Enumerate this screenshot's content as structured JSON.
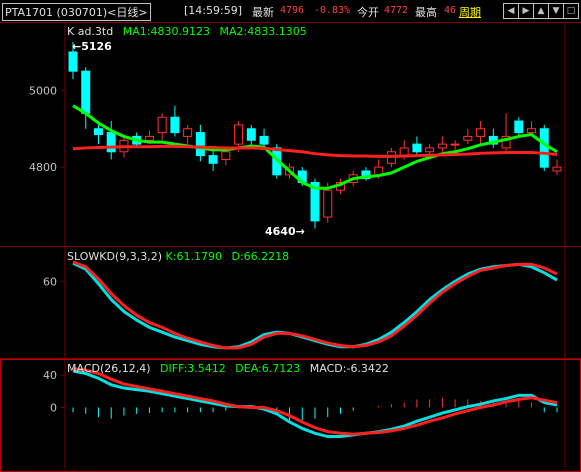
{
  "topbar": {
    "symbol": "PTA1701",
    "contract": "(030701)",
    "period_label": "<日线>",
    "time": "[14:59:59]",
    "last_label": "最新",
    "last_value": "4796",
    "change": "-0.83%",
    "open_label": "今开",
    "open_value": "4772",
    "high_label": "最高",
    "high_value": "46",
    "period_button": "周期",
    "nav_icons": [
      "arrow-left-icon",
      "arrow-right-icon",
      "zoom-in-icon",
      "zoom-out-icon",
      "expand-icon"
    ]
  },
  "colors": {
    "up": "#ff3030",
    "down": "#00ffff",
    "ma1": "#ffffff",
    "ma2": "#00ff00",
    "axis": "#800000"
  },
  "chart_data": [
    {
      "type": "candlestick",
      "name": "K ad.3td",
      "indicators": [
        {
          "label": "MA1",
          "value": "4830.9123"
        },
        {
          "label": "MA2",
          "value": "4833.1305"
        }
      ],
      "yticks": [
        5000,
        4800
      ],
      "ylim": [
        4605,
        5165
      ],
      "annotations": {
        "high": "5126",
        "low": "4640"
      },
      "candles": [
        {
          "o": 5100,
          "c": 5050,
          "h": 5126,
          "l": 5030
        },
        {
          "o": 5050,
          "c": 4940,
          "h": 5060,
          "l": 4900
        },
        {
          "o": 4900,
          "c": 4885,
          "h": 4920,
          "l": 4860
        },
        {
          "o": 4890,
          "c": 4840,
          "h": 4920,
          "l": 4820
        },
        {
          "o": 4840,
          "c": 4870,
          "h": 4880,
          "l": 4825
        },
        {
          "o": 4880,
          "c": 4860,
          "h": 4890,
          "l": 4850
        },
        {
          "o": 4870,
          "c": 4880,
          "h": 4895,
          "l": 4860
        },
        {
          "o": 4890,
          "c": 4930,
          "h": 4940,
          "l": 4870
        },
        {
          "o": 4930,
          "c": 4890,
          "h": 4960,
          "l": 4880
        },
        {
          "o": 4880,
          "c": 4900,
          "h": 4910,
          "l": 4860
        },
        {
          "o": 4890,
          "c": 4830,
          "h": 4910,
          "l": 4815
        },
        {
          "o": 4830,
          "c": 4810,
          "h": 4850,
          "l": 4790
        },
        {
          "o": 4820,
          "c": 4840,
          "h": 4850,
          "l": 4805
        },
        {
          "o": 4860,
          "c": 4910,
          "h": 4920,
          "l": 4840
        },
        {
          "o": 4900,
          "c": 4870,
          "h": 4910,
          "l": 4850
        },
        {
          "o": 4880,
          "c": 4860,
          "h": 4900,
          "l": 4850
        },
        {
          "o": 4850,
          "c": 4780,
          "h": 4860,
          "l": 4770
        },
        {
          "o": 4780,
          "c": 4800,
          "h": 4810,
          "l": 4770
        },
        {
          "o": 4790,
          "c": 4760,
          "h": 4800,
          "l": 4750
        },
        {
          "o": 4760,
          "c": 4660,
          "h": 4770,
          "l": 4640
        },
        {
          "o": 4670,
          "c": 4740,
          "h": 4760,
          "l": 4655
        },
        {
          "o": 4740,
          "c": 4760,
          "h": 4770,
          "l": 4730
        },
        {
          "o": 4760,
          "c": 4780,
          "h": 4790,
          "l": 4750
        },
        {
          "o": 4790,
          "c": 4770,
          "h": 4800,
          "l": 4765
        },
        {
          "o": 4780,
          "c": 4800,
          "h": 4820,
          "l": 4770
        },
        {
          "o": 4810,
          "c": 4840,
          "h": 4850,
          "l": 4800
        },
        {
          "o": 4830,
          "c": 4850,
          "h": 4870,
          "l": 4820
        },
        {
          "o": 4860,
          "c": 4840,
          "h": 4880,
          "l": 4830
        },
        {
          "o": 4840,
          "c": 4850,
          "h": 4860,
          "l": 4830
        },
        {
          "o": 4850,
          "c": 4860,
          "h": 4880,
          "l": 4840
        },
        {
          "o": 4860,
          "c": 4860,
          "h": 4870,
          "l": 4840
        },
        {
          "o": 4870,
          "c": 4880,
          "h": 4900,
          "l": 4860
        },
        {
          "o": 4880,
          "c": 4900,
          "h": 4920,
          "l": 4860
        },
        {
          "o": 4880,
          "c": 4860,
          "h": 4900,
          "l": 4850
        },
        {
          "o": 4850,
          "c": 4880,
          "h": 4940,
          "l": 4840
        },
        {
          "o": 4920,
          "c": 4890,
          "h": 4930,
          "l": 4880
        },
        {
          "o": 4890,
          "c": 4900,
          "h": 4920,
          "l": 4880
        },
        {
          "o": 4900,
          "c": 4800,
          "h": 4910,
          "l": 4790
        },
        {
          "o": 4790,
          "c": 4800,
          "h": 4820,
          "l": 4780
        }
      ],
      "ma_series": [
        {
          "name": "MA1",
          "color": "#00ff00",
          "values": [
            4960,
            4940,
            4915,
            4895,
            4880,
            4870,
            4865,
            4865,
            4860,
            4855,
            4850,
            4845,
            4845,
            4850,
            4855,
            4852,
            4820,
            4790,
            4760,
            4745,
            4745,
            4755,
            4770,
            4775,
            4778,
            4785,
            4800,
            4815,
            4825,
            4835,
            4840,
            4848,
            4858,
            4865,
            4872,
            4880,
            4885,
            4860,
            4840
          ]
        },
        {
          "name": "MA2",
          "color": "#ff2020",
          "values": [
            4848,
            4850,
            4851,
            4852,
            4853,
            4853,
            4853,
            4854,
            4854,
            4853,
            4852,
            4851,
            4850,
            4850,
            4850,
            4849,
            4846,
            4843,
            4840,
            4835,
            4832,
            4830,
            4829,
            4829,
            4828,
            4828,
            4829,
            4830,
            4831,
            4832,
            4833,
            4834,
            4836,
            4837,
            4838,
            4838,
            4838,
            4836,
            4833
          ]
        }
      ]
    },
    {
      "type": "line",
      "name": "SLOWKD(9,3,3,2)",
      "indicators": [
        {
          "label": "K",
          "value": "61.1790"
        },
        {
          "label": "D",
          "value": "66.2218"
        }
      ],
      "yticks": [
        60
      ],
      "ylim": [
        0,
        85
      ],
      "series": [
        {
          "name": "K",
          "color": "#00e0e0",
          "values": [
            75,
            70,
            58,
            45,
            35,
            28,
            22,
            18,
            14,
            11,
            8,
            6,
            5,
            6,
            10,
            16,
            18,
            17,
            14,
            11,
            8,
            6,
            6,
            8,
            12,
            18,
            26,
            35,
            45,
            53,
            60,
            66,
            70,
            72,
            73,
            74,
            72,
            67,
            61
          ]
        },
        {
          "name": "D",
          "color": "#ff2020",
          "values": [
            76,
            72,
            62,
            50,
            40,
            32,
            26,
            22,
            17,
            13,
            10,
            7,
            5,
            5,
            8,
            14,
            17,
            17,
            15,
            12,
            9,
            7,
            6,
            7,
            10,
            15,
            23,
            32,
            42,
            51,
            58,
            64,
            69,
            71,
            73,
            74,
            74,
            71,
            66
          ]
        }
      ]
    },
    {
      "type": "bar",
      "name": "MACD(26,12,4)",
      "indicators": [
        {
          "label": "DIFF",
          "value": "3.5412"
        },
        {
          "label": "DEA",
          "value": "6.7123"
        },
        {
          "label": "MACD",
          "value": "-6.3422"
        }
      ],
      "yticks": [
        40,
        0
      ],
      "ylim": [
        -70,
        55
      ],
      "series": [
        {
          "name": "DIFF",
          "color": "#00e0e0",
          "values": [
            45,
            42,
            36,
            28,
            24,
            22,
            20,
            17,
            14,
            11,
            8,
            5,
            2,
            1,
            1,
            -2,
            -8,
            -18,
            -26,
            -32,
            -36,
            -36,
            -34,
            -32,
            -30,
            -27,
            -23,
            -17,
            -12,
            -7,
            -3,
            1,
            4,
            8,
            11,
            15,
            15,
            6,
            3
          ]
        },
        {
          "name": "DEA",
          "color": "#ff2020",
          "values": [
            48,
            46,
            42,
            35,
            29,
            26,
            23,
            20,
            17,
            14,
            11,
            8,
            4,
            1,
            0,
            0,
            -4,
            -10,
            -18,
            -25,
            -30,
            -32,
            -33,
            -32,
            -31,
            -29,
            -26,
            -22,
            -17,
            -13,
            -8,
            -4,
            0,
            3,
            7,
            10,
            12,
            9,
            6
          ]
        },
        {
          "name": "MACD",
          "color": "#00e0e0",
          "values": [
            -6,
            -8,
            -12,
            -14,
            -10,
            -8,
            -7,
            -6,
            -6,
            -6,
            -6,
            -6,
            -4,
            -1,
            2,
            -4,
            -8,
            -16,
            -16,
            -14,
            -12,
            -8,
            -4,
            0,
            2,
            4,
            6,
            10,
            10,
            12,
            10,
            10,
            8,
            10,
            8,
            10,
            6,
            -6,
            -6
          ]
        }
      ]
    }
  ]
}
